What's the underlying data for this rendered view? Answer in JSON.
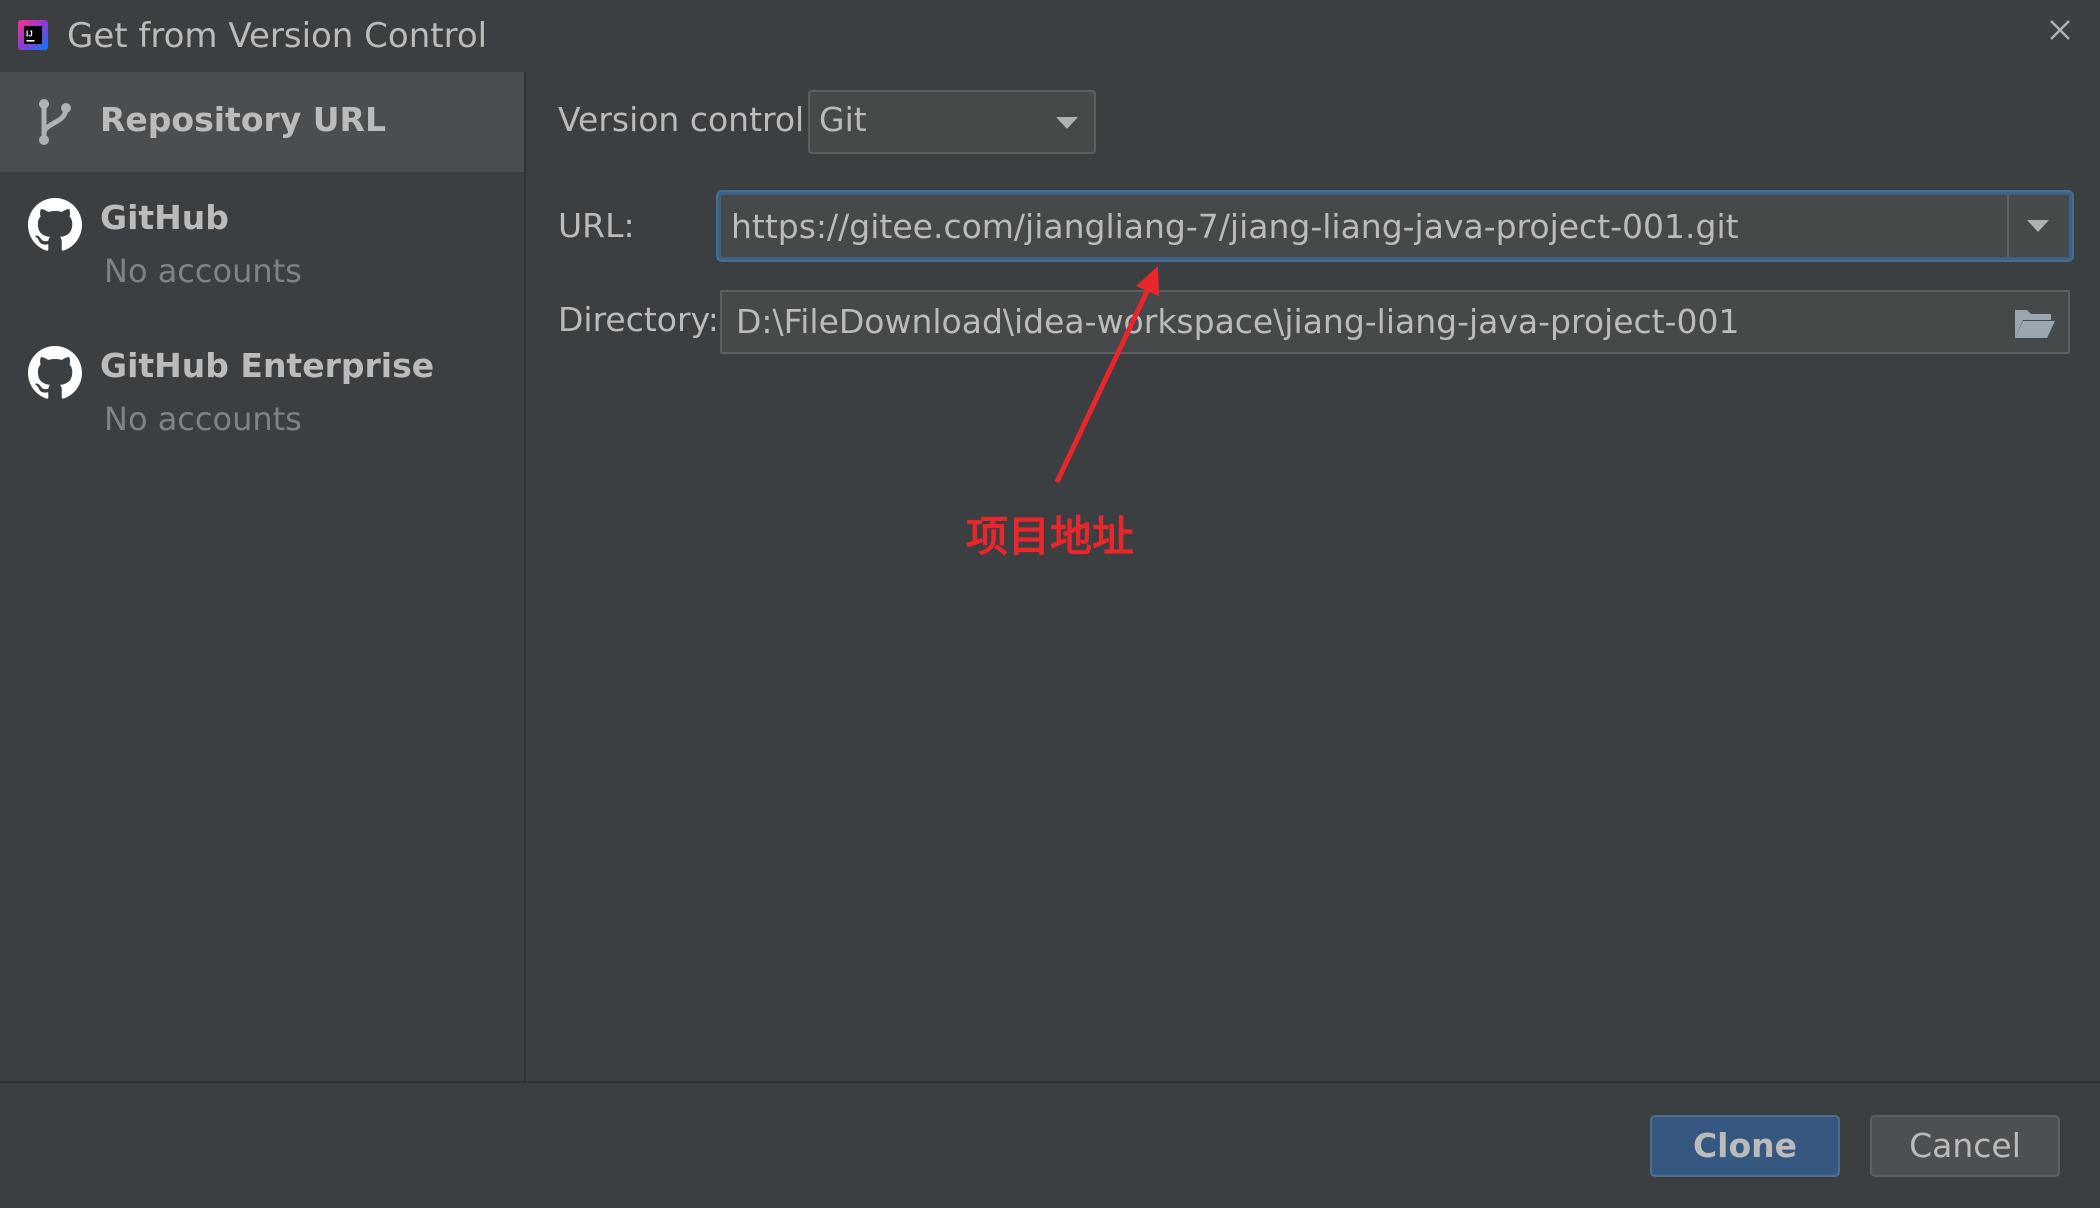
{
  "window": {
    "title": "Get from Version Control",
    "app_icon": "intellij-idea-icon",
    "close_icon": "close-icon"
  },
  "sidebar": {
    "items": [
      {
        "label": "Repository URL",
        "sublabel": "",
        "icon": "vcs-branch-icon",
        "selected": true
      },
      {
        "label": "GitHub",
        "sublabel": "No accounts",
        "icon": "github-icon",
        "selected": false
      },
      {
        "label": "GitHub Enterprise",
        "sublabel": "No accounts",
        "icon": "github-icon",
        "selected": false
      }
    ]
  },
  "form": {
    "version_control_label": "Version control:",
    "version_control_value": "Git",
    "url_label": "URL:",
    "url_value": "https://gitee.com/jiangliang-7/jiang-liang-java-project-001.git",
    "directory_label": "Directory:",
    "directory_value": "D:\\FileDownload\\idea-workspace\\jiang-liang-java-project-001"
  },
  "annotation": {
    "text": "项目地址",
    "color": "#e8262b"
  },
  "buttons": {
    "clone": "Clone",
    "cancel": "Cancel"
  },
  "colors": {
    "background": "#3c3f41",
    "selected_item": "#4b4e51",
    "focus_border": "#466d94",
    "primary_button": "#365880"
  }
}
